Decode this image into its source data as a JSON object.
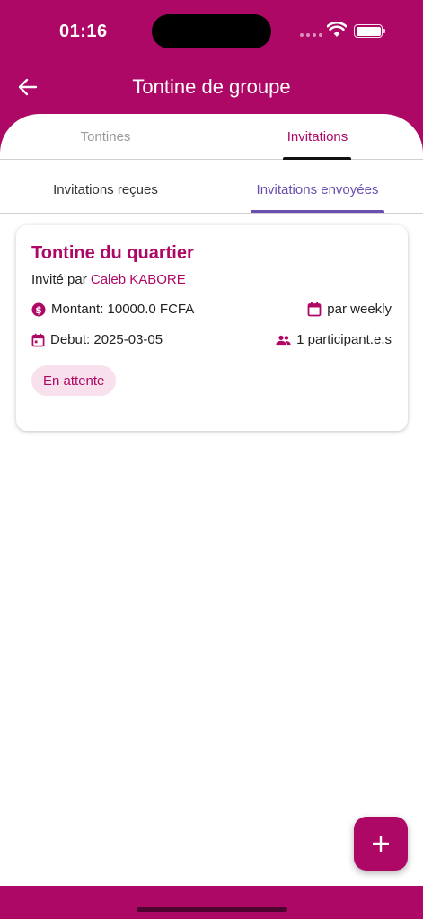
{
  "status_bar": {
    "time": "01:16"
  },
  "header": {
    "title": "Tontine de groupe",
    "back_icon": "arrow-left-icon"
  },
  "main_tabs": [
    {
      "label": "Tontines",
      "selected": false
    },
    {
      "label": "Invitations",
      "selected": true
    }
  ],
  "sub_tabs": [
    {
      "label": "Invitations reçues",
      "selected": false
    },
    {
      "label": "Invitations envoyées",
      "selected": true
    }
  ],
  "invitation": {
    "title": "Tontine du quartier",
    "invited_by_prefix": "Invité par",
    "invited_by_name": "Caleb KABORE",
    "amount": "Montant: 10000.0 FCFA",
    "frequency": "par weekly",
    "start": "Debut: 2025-03-05",
    "participants": "1 participant.e.s",
    "status": "En attente"
  },
  "fab": {
    "icon": "plus-icon"
  },
  "colors": {
    "brand": "#ad0866",
    "subtab_accent": "#6a4fb0",
    "badge_bg": "#f8e1ec"
  }
}
